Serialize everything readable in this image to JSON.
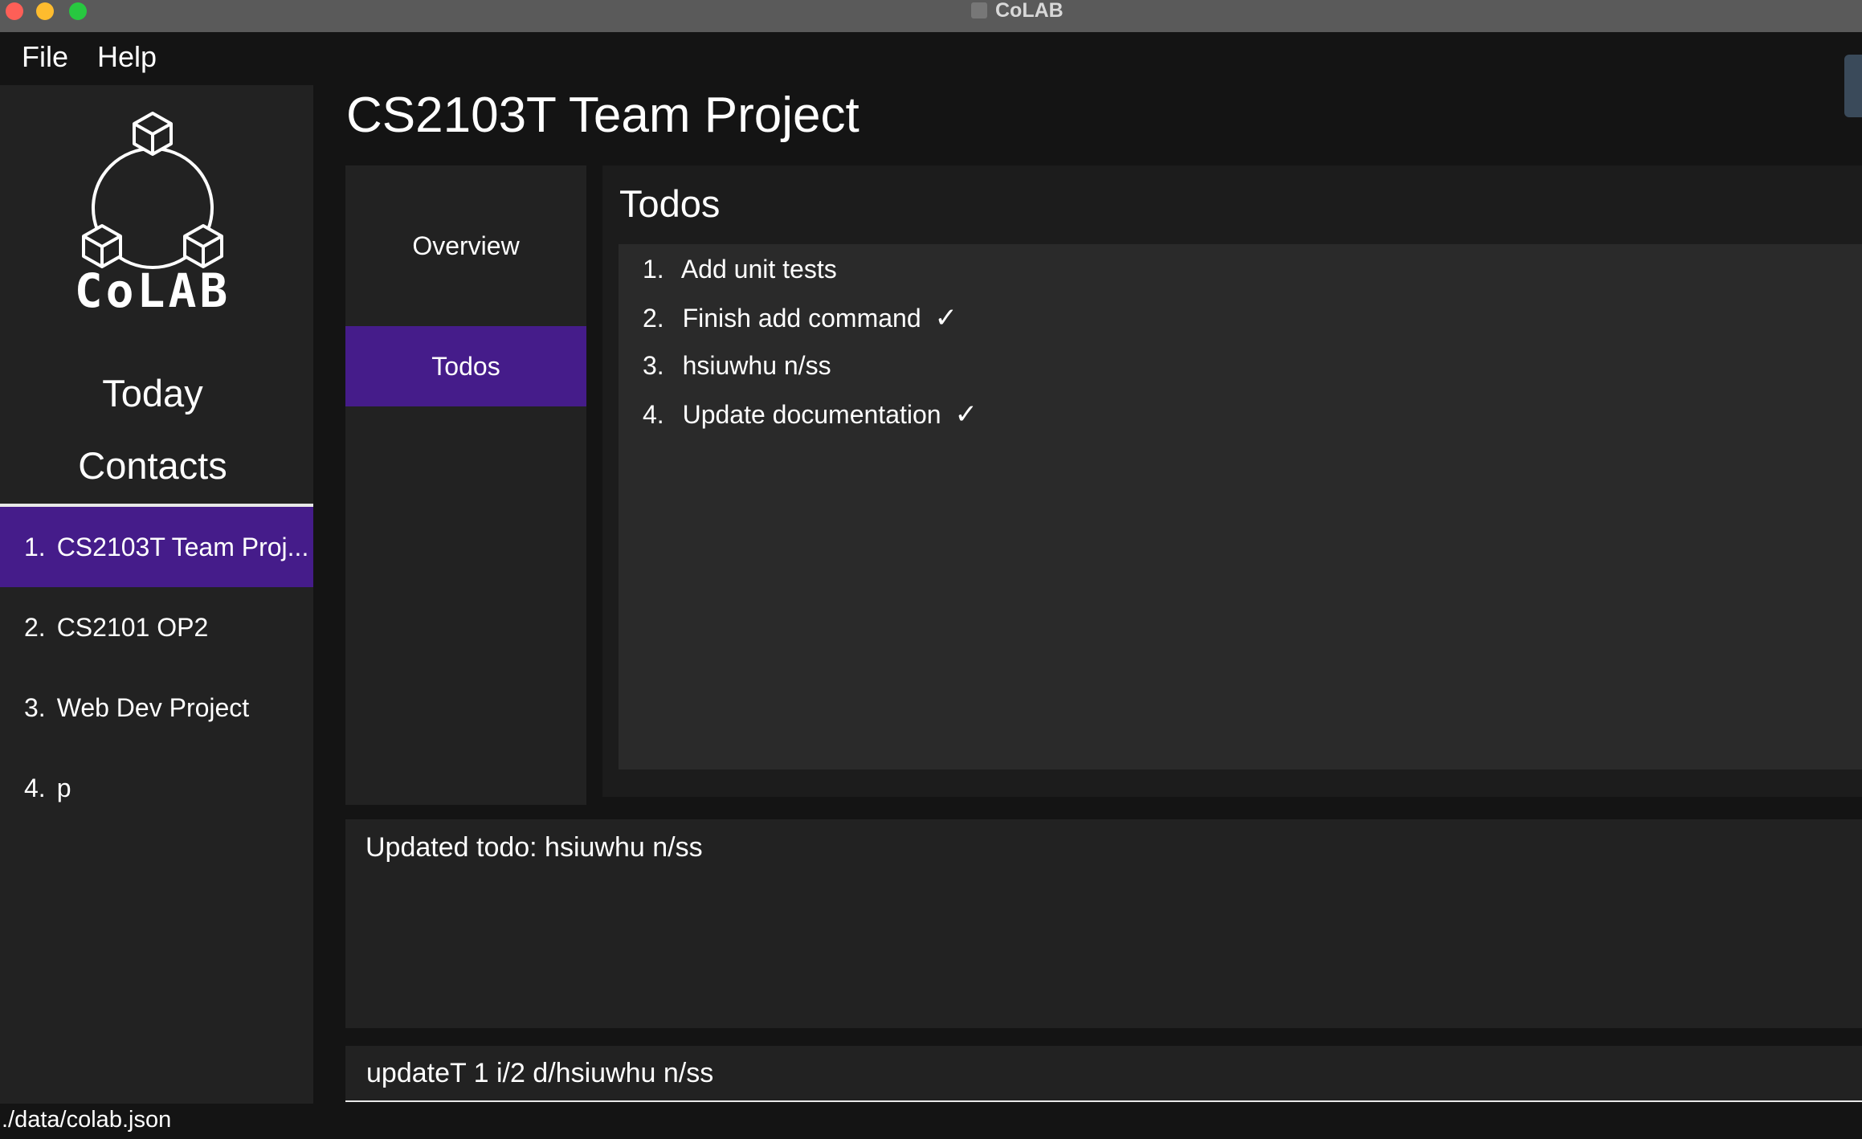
{
  "window": {
    "title": "CoLAB"
  },
  "menu": {
    "file": "File",
    "help": "Help"
  },
  "sidebar": {
    "logo_text": "CoLAB",
    "today": "Today",
    "contacts": "Contacts",
    "projects": [
      {
        "index": "1.",
        "name": "CS2103T Team Proj...",
        "selected": true
      },
      {
        "index": "2.",
        "name": "CS2101 OP2",
        "selected": false
      },
      {
        "index": "3.",
        "name": "Web Dev Project",
        "selected": false
      },
      {
        "index": "4.",
        "name": "p",
        "selected": false
      }
    ]
  },
  "main": {
    "title": "CS2103T Team Project",
    "tabs": [
      {
        "label": "Overview",
        "active": false
      },
      {
        "label": "Todos",
        "active": true
      }
    ],
    "todos": {
      "heading": "Todos",
      "items": [
        {
          "index": "1.",
          "text": "Add unit tests",
          "check": ""
        },
        {
          "index": "2.",
          "text": "Finish add command",
          "check": "✓"
        },
        {
          "index": "3.",
          "text": "hsiuwhu n/ss",
          "check": ""
        },
        {
          "index": "4.",
          "text": "Update documentation",
          "check": "✓"
        }
      ]
    },
    "result": "Updated todo: hsiuwhu n/ss",
    "command": "updateT 1 i/2 d/hsiuwhu n/ss"
  },
  "status_bar": {
    "path": "./data/colab.json"
  },
  "colors": {
    "accent": "#451c8a",
    "background": "#141414",
    "panel": "#222222"
  }
}
